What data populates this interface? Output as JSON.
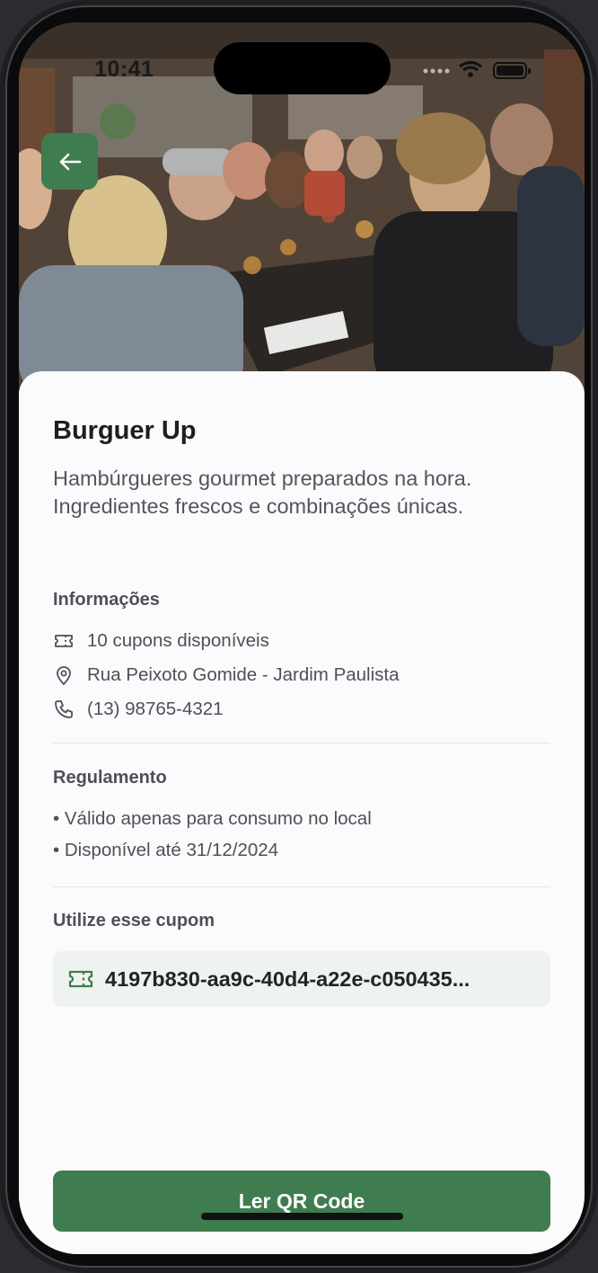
{
  "status_bar": {
    "time": "10:41"
  },
  "restaurant": {
    "name": "Burguer Up",
    "description": "Hambúrgueres gourmet preparados na hora. Ingredientes frescos e combinações únicas."
  },
  "info": {
    "heading": "Informações",
    "coupons_available": "10 cupons disponíveis",
    "address": "Rua Peixoto Gomide - Jardim Paulista",
    "phone": "(13) 98765-4321"
  },
  "rules": {
    "heading": "Regulamento",
    "items": [
      "• Válido apenas para consumo no local",
      "• Disponível até 31/12/2024"
    ]
  },
  "coupon": {
    "heading": "Utilize esse cupom",
    "code": "4197b830-aa9c-40d4-a22e-c050435..."
  },
  "actions": {
    "scan_qr_label": "Ler QR Code"
  },
  "colors": {
    "accent": "#3f7c4f",
    "coupon_bg": "#eef3ef",
    "text": "#1e1e20",
    "muted": "#4f5056"
  },
  "icons": {
    "back": "arrow-left-icon",
    "ticket": "ticket-icon",
    "location": "map-pin-icon",
    "phone": "phone-icon",
    "coupon": "ticket-icon"
  }
}
